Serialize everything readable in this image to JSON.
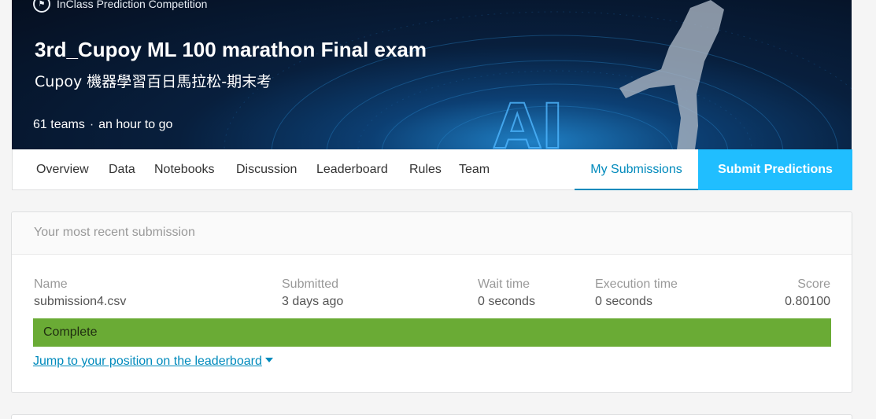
{
  "competition": {
    "type_label": "InClass Prediction Competition",
    "title": "3rd_Cupoy ML 100 marathon Final exam",
    "subtitle": "Cupoy 機器學習百日馬拉松-期末考",
    "teams": "61 teams",
    "separator": "·",
    "deadline": "an hour to go",
    "art_text": "AI"
  },
  "tabs": {
    "overview": "Overview",
    "data": "Data",
    "notebooks": "Notebooks",
    "discussion": "Discussion",
    "leaderboard": "Leaderboard",
    "rules": "Rules",
    "team": "Team",
    "my_submissions": "My Submissions",
    "submit_predictions": "Submit Predictions"
  },
  "submission": {
    "header": "Your most recent submission",
    "name_label": "Name",
    "name": "submission4.csv",
    "submitted_label": "Submitted",
    "submitted": "3 days ago",
    "wait_label": "Wait time",
    "wait": "0 seconds",
    "exec_label": "Execution time",
    "exec": "0 seconds",
    "score_label": "Score",
    "score": "0.80100",
    "status": "Complete",
    "jump_link": "Jump to your position on the leaderboard"
  },
  "colors": {
    "accent": "#20beff",
    "link": "#008abc",
    "status_complete": "#6aab35"
  }
}
